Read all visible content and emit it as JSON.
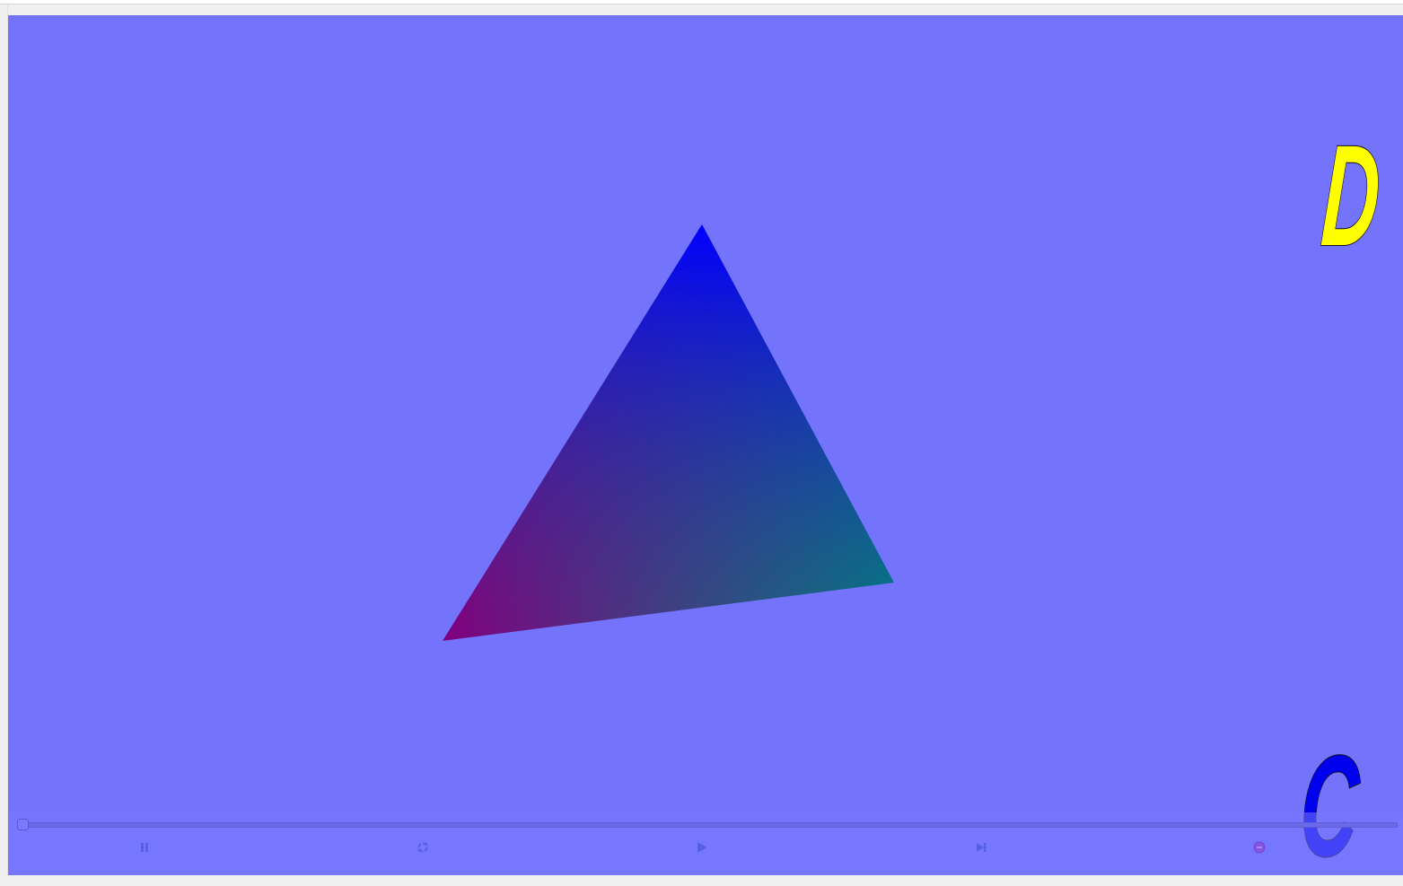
{
  "viewport": {
    "background_color": "#7373fc",
    "triangle_colors": {
      "top_vertex": "#0000ff",
      "right_vertex": "#008080",
      "left_vertex": "#800080"
    }
  },
  "overlay": {
    "letter_top_right": "D",
    "letter_top_right_color": "#ffff00",
    "letter_bottom_right": "C",
    "letter_bottom_right_color": "#0000ee"
  },
  "player": {
    "progress": 0,
    "buttons": [
      {
        "icon": "pause-icon"
      },
      {
        "icon": "loop-icon"
      },
      {
        "icon": "play-icon"
      },
      {
        "icon": "skip-forward-icon"
      },
      {
        "icon": "record-icon"
      }
    ]
  }
}
